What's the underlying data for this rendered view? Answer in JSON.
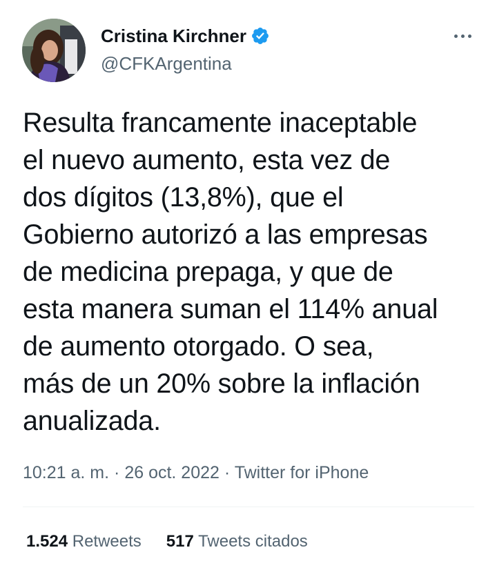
{
  "author": {
    "name": "Cristina Kirchner",
    "handle": "@CFKArgentina"
  },
  "tweet": {
    "text": "Resulta francamente inaceptable\nel nuevo aumento, esta vez de\ndos dígitos (13,8%), que el\nGobierno autorizó a las empresas\nde medicina prepaga, y que de\nesta manera suman el 114% anual\nde aumento otorgado. O sea,\nmás de un 20% sobre la inflación\nanualizada.",
    "time": "10:21 a. m.",
    "date": "26 oct. 2022",
    "source": "Twitter for iPhone",
    "separator": "·"
  },
  "stats": {
    "retweets_count": "1.524",
    "retweets_label": "Retweets",
    "quotes_count": "517",
    "quotes_label": "Tweets citados"
  },
  "icons": {
    "verified": "verified-badge-icon",
    "more": "more-options-icon"
  },
  "colors": {
    "verified": "#1d9bf0",
    "secondary_text": "#536471",
    "primary_text": "#0f1419",
    "divider": "#eff3f4"
  }
}
